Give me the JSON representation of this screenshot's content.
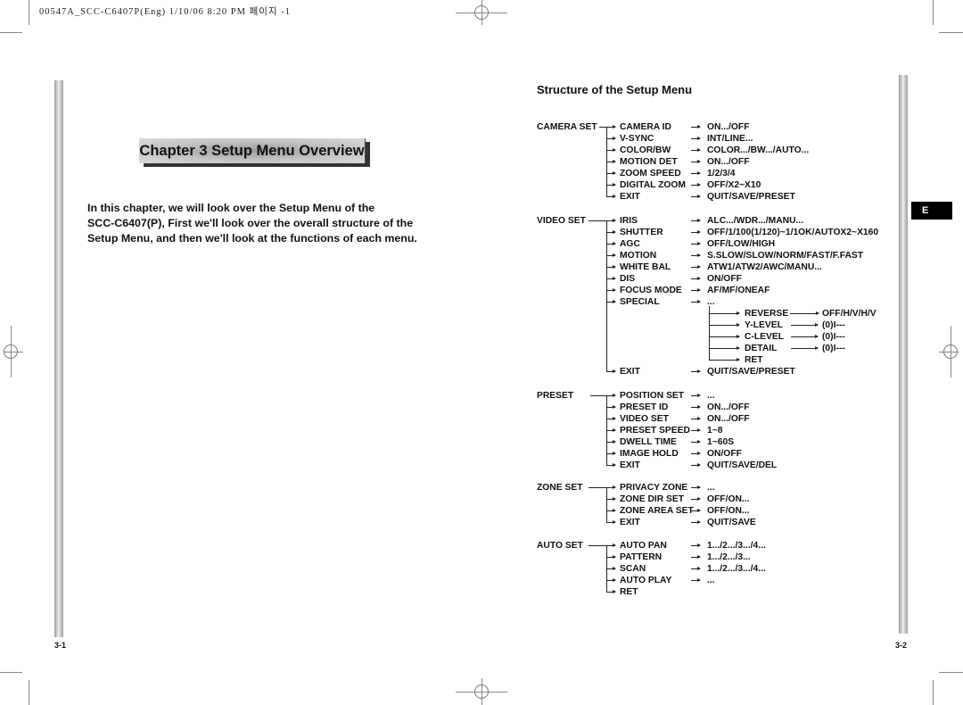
{
  "print_header": "00547A_SCC-C6407P(Eng)  1/10/06 8:20 PM 페이지 -1",
  "left_page": {
    "chapter_title": "Chapter 3  Setup Menu Overview",
    "intro_lines": [
      "In this chapter, we will look over the Setup Menu of the",
      "SCC-C6407(P), First we'll look over the overall structure of the",
      "Setup Menu, and then we'll look at the functions of each menu."
    ],
    "page_number": "3-1"
  },
  "right_page": {
    "section_title": "Structure of the Setup Menu",
    "language_tab": "E",
    "page_number": "3-2",
    "menu_groups": [
      {
        "name": "CAMERA SET",
        "items": [
          {
            "label": "CAMERA ID",
            "value": "ON.../OFF"
          },
          {
            "label": "V-SYNC",
            "value": "INT/LINE..."
          },
          {
            "label": "COLOR/BW",
            "value": "COLOR.../BW.../AUTO..."
          },
          {
            "label": "MOTION DET",
            "value": "ON.../OFF"
          },
          {
            "label": "ZOOM SPEED",
            "value": "1/2/3/4"
          },
          {
            "label": "DIGITAL ZOOM",
            "value": "OFF/X2~X10"
          },
          {
            "label": "EXIT",
            "value": "QUIT/SAVE/PRESET"
          }
        ]
      },
      {
        "name": "VIDEO SET",
        "items": [
          {
            "label": "IRIS",
            "value": "ALC.../WDR.../MANU..."
          },
          {
            "label": "SHUTTER",
            "value": "OFF/1/100(1/120)~1/1OK/AUTOX2~X160"
          },
          {
            "label": "AGC",
            "value": "OFF/LOW/HIGH"
          },
          {
            "label": "MOTION",
            "value": "S.SLOW/SLOW/NORM/FAST/F.FAST"
          },
          {
            "label": "WHITE BAL",
            "value": "ATW1/ATW2/AWC/MANU..."
          },
          {
            "label": "DIS",
            "value": "ON/OFF"
          },
          {
            "label": "FOCUS MODE",
            "value": "AF/MF/ONEAF"
          },
          {
            "label": "SPECIAL",
            "value": "..."
          }
        ],
        "special_sub": [
          {
            "label": "REVERSE",
            "value": "OFF/H/V/H/V"
          },
          {
            "label": "Y-LEVEL",
            "value": "(0)I---"
          },
          {
            "label": "C-LEVEL",
            "value": "(0)I---"
          },
          {
            "label": "DETAIL",
            "value": "(0)I---"
          },
          {
            "label": "RET",
            "value": ""
          }
        ],
        "exit": {
          "label": "EXIT",
          "value": "QUIT/SAVE/PRESET"
        }
      },
      {
        "name": "PRESET",
        "items": [
          {
            "label": "POSITION SET",
            "value": "..."
          },
          {
            "label": "PRESET ID",
            "value": "ON.../OFF"
          },
          {
            "label": "VIDEO SET",
            "value": "ON.../OFF"
          },
          {
            "label": "PRESET SPEED",
            "value": "1~8"
          },
          {
            "label": "DWELL TIME",
            "value": "1~60S"
          },
          {
            "label": "IMAGE HOLD",
            "value": "ON/OFF"
          },
          {
            "label": "EXIT",
            "value": "QUIT/SAVE/DEL"
          }
        ]
      },
      {
        "name": "ZONE SET",
        "items": [
          {
            "label": "PRIVACY ZONE",
            "value": "..."
          },
          {
            "label": "ZONE DIR SET",
            "value": "OFF/ON..."
          },
          {
            "label": "ZONE AREA SET",
            "value": "OFF/ON..."
          },
          {
            "label": "EXIT",
            "value": "QUIT/SAVE"
          }
        ]
      },
      {
        "name": "AUTO SET",
        "items": [
          {
            "label": "AUTO PAN",
            "value": "1.../2.../3.../4..."
          },
          {
            "label": "PATTERN",
            "value": "1.../2.../3..."
          },
          {
            "label": "SCAN",
            "value": "1.../2.../3.../4..."
          },
          {
            "label": "AUTO PLAY",
            "value": "..."
          },
          {
            "label": "RET",
            "value": ""
          }
        ]
      }
    ]
  }
}
